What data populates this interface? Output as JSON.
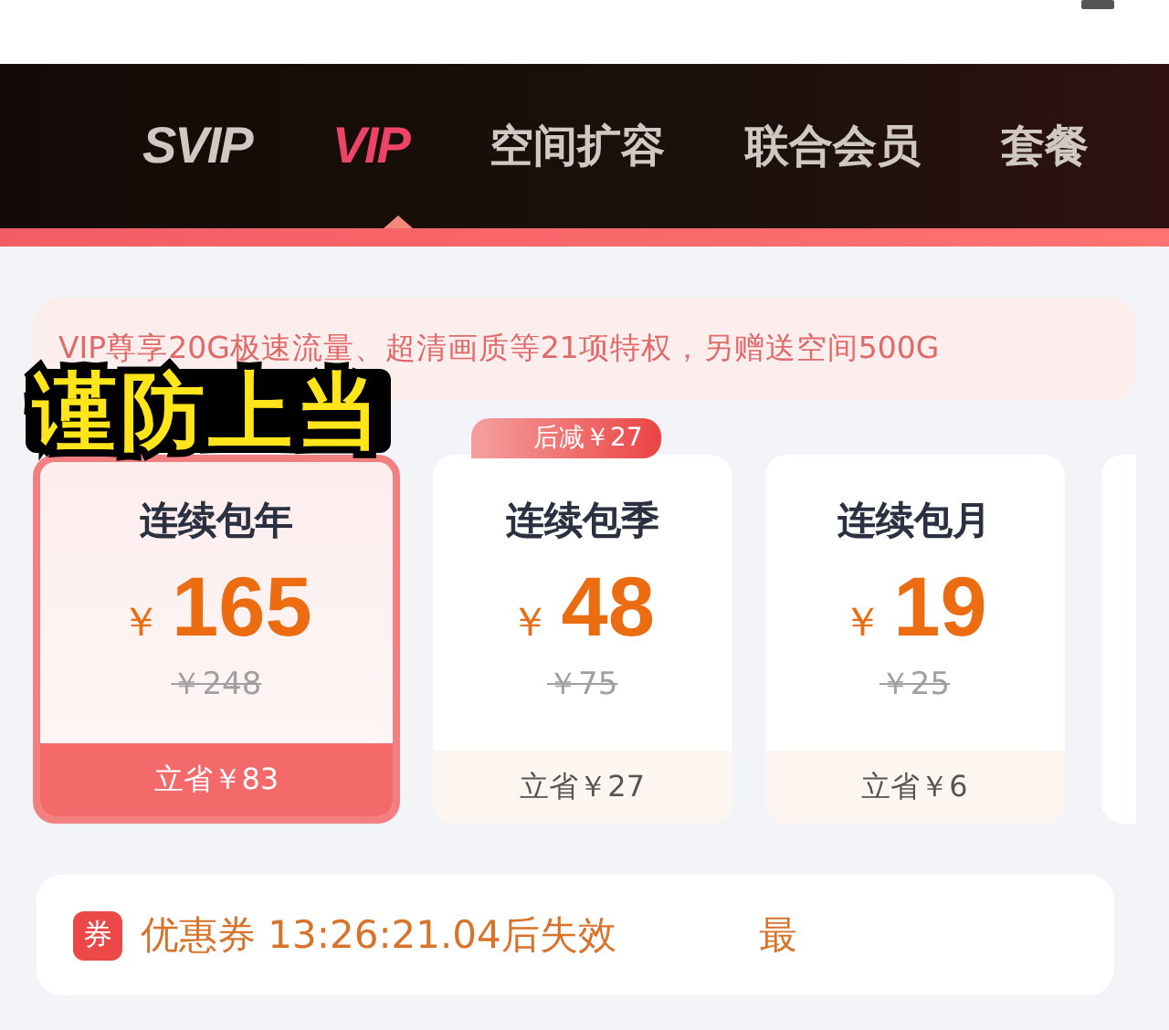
{
  "tabs": [
    {
      "label": "SVIP",
      "kind": "logo",
      "selected": false
    },
    {
      "label": "VIP",
      "kind": "logo",
      "selected": true
    },
    {
      "label": "空间扩容",
      "kind": "text",
      "selected": false
    },
    {
      "label": "联合会员",
      "kind": "text",
      "selected": false
    },
    {
      "label": "套餐",
      "kind": "text",
      "selected": false
    }
  ],
  "banner": "VIP尊享20G极速流量、超清画质等21项特权，另赠送空间500G",
  "caption": "谨防上当",
  "promo_badge": "后减￥27",
  "plans": [
    {
      "name": "连续包年",
      "currency": "￥",
      "price": "165",
      "original": "￥248",
      "saving": "立省￥83",
      "selected": true
    },
    {
      "name": "连续包季",
      "currency": "￥",
      "price": "48",
      "original": "￥75",
      "saving": "立省￥27",
      "selected": false
    },
    {
      "name": "连续包月",
      "currency": "￥",
      "price": "19",
      "original": "￥25",
      "saving": "立省￥6",
      "selected": false
    }
  ],
  "coupon": {
    "icon": "券",
    "text": "优惠券 13:26:21.04后失效",
    "link": "最"
  }
}
